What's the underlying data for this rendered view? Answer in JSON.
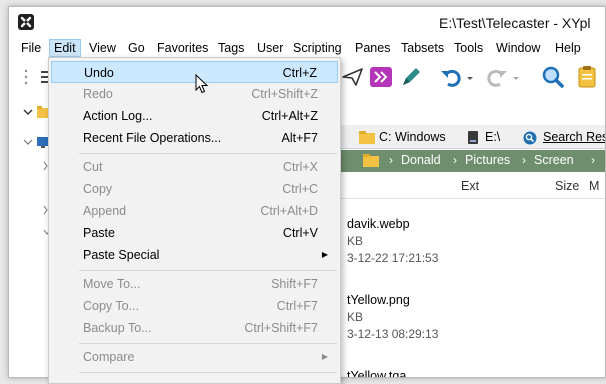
{
  "window": {
    "title": "E:\\Test\\Telecaster - XYpl"
  },
  "menubar": {
    "items": [
      "File",
      "Edit",
      "View",
      "Go",
      "Favorites",
      "Tags",
      "User",
      "Scripting",
      "Panes",
      "Tabsets",
      "Tools",
      "Window",
      "Help"
    ]
  },
  "tabs": [
    {
      "label": "C: Windows"
    },
    {
      "label": "E:\\"
    },
    {
      "label": "Search Resu"
    }
  ],
  "breadcrumb": [
    "Donald",
    "Pictures",
    "Screen"
  ],
  "columns": {
    "ext": "Ext",
    "size": "Size",
    "modified": "M"
  },
  "files": [
    {
      "name": "davik.webp",
      "size": "KB",
      "date": "3-12-22 17:21:53"
    },
    {
      "name": "tYellow.png",
      "size": "KB",
      "date": "3-12-13 08:29:13"
    },
    {
      "name": "tYellow.tga",
      "size": "",
      "date": ""
    }
  ],
  "edit_menu": {
    "items": [
      {
        "label": "Undo",
        "shortcut": "Ctrl+Z",
        "enabled": true,
        "highlighted": true
      },
      {
        "label": "Redo",
        "shortcut": "Ctrl+Shift+Z",
        "enabled": false
      },
      {
        "label": "Action Log...",
        "shortcut": "Ctrl+Alt+Z",
        "enabled": true
      },
      {
        "label": "Recent File Operations...",
        "shortcut": "Alt+F7",
        "enabled": true
      },
      {
        "label": "Cut",
        "shortcut": "Ctrl+X",
        "enabled": false
      },
      {
        "label": "Copy",
        "shortcut": "Ctrl+C",
        "enabled": false
      },
      {
        "label": "Append",
        "shortcut": "Ctrl+Alt+D",
        "enabled": false
      },
      {
        "label": "Paste",
        "shortcut": "Ctrl+V",
        "enabled": true
      },
      {
        "label": "Paste Special",
        "shortcut": "",
        "enabled": true,
        "submenu": true
      },
      {
        "label": "Move To...",
        "shortcut": "Shift+F7",
        "enabled": false
      },
      {
        "label": "Copy To...",
        "shortcut": "Ctrl+F7",
        "enabled": false
      },
      {
        "label": "Backup To...",
        "shortcut": "Ctrl+Shift+F7",
        "enabled": false
      },
      {
        "label": "Compare",
        "shortcut": "",
        "enabled": false,
        "submenu": true
      }
    ]
  },
  "colors": {
    "breadcrumb_bg": "#6e8e6d",
    "menu_highlight": "#cce8ff",
    "accent_blue": "#1f6fb5",
    "folder_yellow": "#f4c242"
  },
  "icons": [
    "app-logo-icon",
    "view-list-icon",
    "send-icon",
    "xyplorer-arrow-icon",
    "pen-icon",
    "undo-icon",
    "redo-icon",
    "search-icon",
    "clipboard-icon",
    "folder-icon",
    "drive-icon",
    "search-tab-icon",
    "mouse-cursor-icon"
  ]
}
